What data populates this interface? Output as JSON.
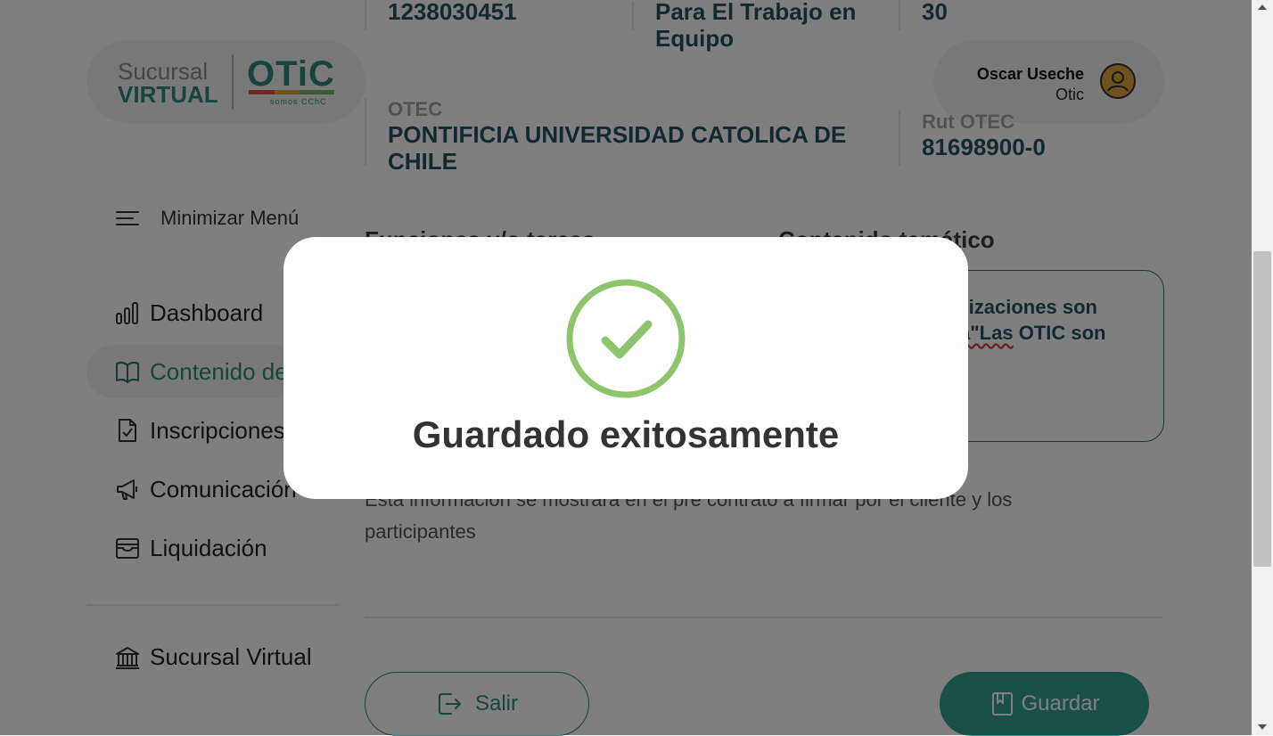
{
  "brand": {
    "sucursal": "Sucursal",
    "virtual": "VIRTUAL",
    "otic": "OTiC",
    "tagline": "somos CChC"
  },
  "user": {
    "name": "Oscar Useche",
    "role": "Otic",
    "icon": "user-circle-icon"
  },
  "sidebar": {
    "toggle_label": "Minimizar Menú",
    "items": [
      {
        "label": "Dashboard",
        "icon": "bar-chart-icon",
        "active": false
      },
      {
        "label": "Contenido de",
        "icon": "open-book-icon",
        "active": true
      },
      {
        "label": "Inscripciones",
        "icon": "document-check-icon",
        "active": false
      },
      {
        "label": "Comunicación",
        "icon": "megaphone-icon",
        "active": false
      },
      {
        "label": "Liquidación",
        "icon": "archive-box-icon",
        "active": false
      }
    ],
    "bottom_item": {
      "label": "Sucursal Virtual",
      "icon": "bank-icon"
    }
  },
  "main": {
    "top_fields": [
      {
        "value": "1238030451"
      },
      {
        "value": "Para El Trabajo en Equipo"
      },
      {
        "value": "30"
      }
    ],
    "otec": {
      "label": "OTEC",
      "value": "PONTIFICIA UNIVERSIDAD CATOLICA DE CHILE"
    },
    "rut": {
      "label": "Rut OTEC",
      "value": "81698900-0"
    },
    "funciones_title": "Funciones y/o tareas",
    "contenido_title": "Contenido temático",
    "contenido_line1": "anizaciones son",
    "contenido_line2_a": "a\"Las",
    "contenido_line2_b": " OTIC son",
    "info_text": "Esta información se mostrará en el pre contrato a firmar por el cliente y los participantes",
    "salir_label": "Salir",
    "guardar_label": "Guardar"
  },
  "modal": {
    "title": "Guardado exitosamente",
    "icon": "success-check-icon",
    "accent_color": "#8dc46c"
  },
  "colors": {
    "primary": "#2c8a7c",
    "value_text": "#24545f"
  }
}
